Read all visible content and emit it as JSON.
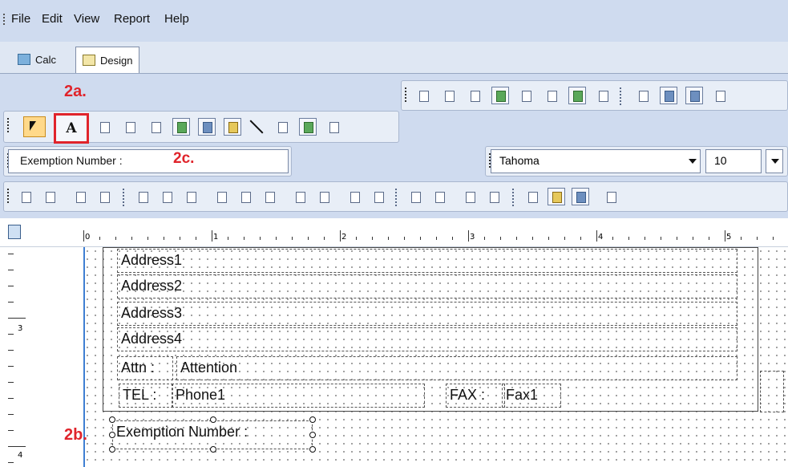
{
  "menu": [
    "File",
    "Edit",
    "View",
    "Report",
    "Help"
  ],
  "tabs": [
    {
      "label": "Calc"
    },
    {
      "label": "Design"
    }
  ],
  "property": {
    "value": "Exemption Number :"
  },
  "font": {
    "name": "Tahoma",
    "size": "10"
  },
  "ruler": {
    "labels": [
      "0",
      "1",
      "2",
      "3",
      "4",
      "5"
    ],
    "v_labels": [
      "3",
      "4"
    ]
  },
  "fields": {
    "address1": "Address1",
    "address2": "Address2",
    "address3": "Address3",
    "address4": "Address4",
    "attn_label": "Attn :",
    "attn_value": "Attention",
    "tel_label": "TEL :",
    "tel_value": "Phone1",
    "fax_label": "FAX :",
    "fax_value": "Fax1",
    "exemption_label": "Exemption Number :"
  },
  "callouts": {
    "a": "2a.",
    "b": "2b.",
    "c": "2c."
  },
  "colors": {
    "callout": "#e0242b",
    "toolbar_bg": "#cfdbef",
    "selection": "#ffd98a"
  },
  "icons": [
    "pointer-tool-icon",
    "label-tool-icon",
    "line-tool-icon",
    "font-dropdown-icon"
  ]
}
